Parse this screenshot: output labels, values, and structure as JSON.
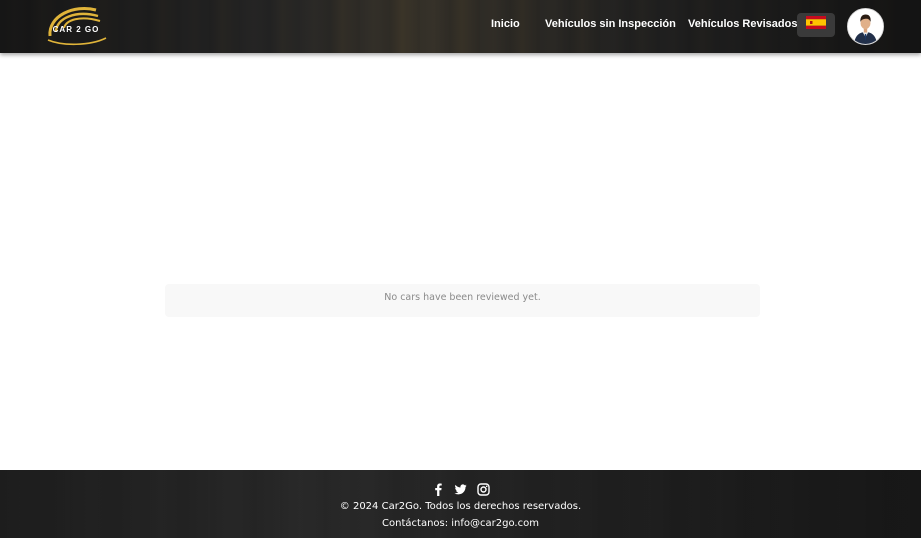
{
  "header": {
    "logo_text": "CAR 2 GO",
    "nav": [
      {
        "label": "Inicio"
      },
      {
        "label": "Vehículos sin Inspección"
      },
      {
        "label": "Vehículos Revisados"
      }
    ],
    "language": {
      "icon": "spain-flag-icon"
    },
    "avatar": {
      "icon": "user-avatar-icon"
    }
  },
  "main": {
    "empty_message": "No cars have been reviewed yet."
  },
  "footer": {
    "social": [
      {
        "icon": "facebook-icon"
      },
      {
        "icon": "twitter-icon"
      },
      {
        "icon": "instagram-icon"
      }
    ],
    "copyright": "© 2024 Car2Go. Todos los derechos reservados.",
    "contact": "Contáctanos: info@car2go.com"
  },
  "colors": {
    "logo_gold": "#e0b43a",
    "header_bg": "#1e1e1e",
    "footer_bg": "#262626",
    "empty_box_bg": "#f8f8f8",
    "empty_text": "#8a8a8a"
  }
}
